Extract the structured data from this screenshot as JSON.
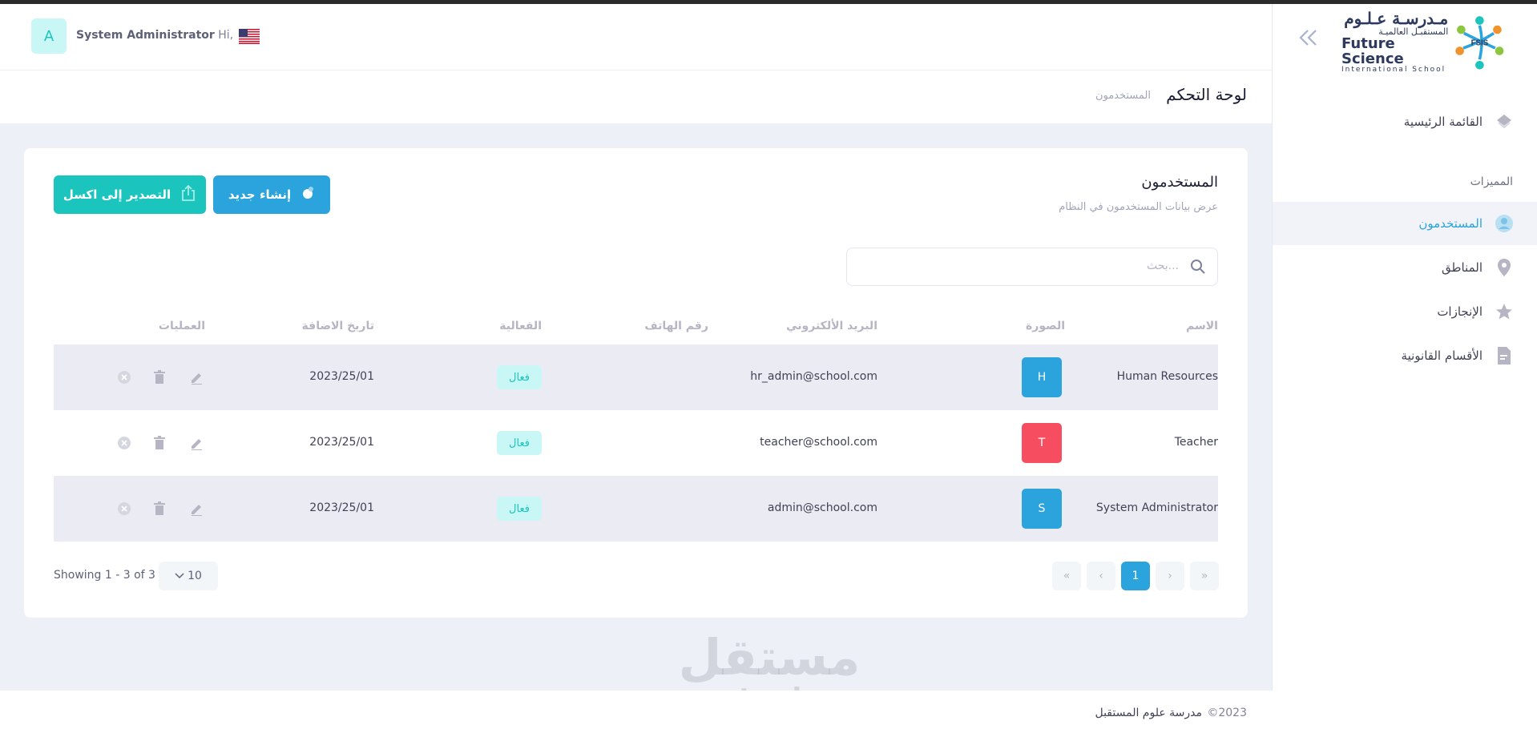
{
  "header": {
    "avatar_letter": "A",
    "greeting_prefix": "Hi,",
    "user_name": "System Administrator",
    "language_flag": "us-flag-icon"
  },
  "sidebar": {
    "logo": {
      "arabic_name": "مـدرسـة عـلـوم",
      "arabic_sub": "المستقبـل العالميـة",
      "english_name": "Future Science",
      "english_sub": "International School",
      "mark": "FSIS"
    },
    "main_menu": "القائمة الرئيسية",
    "section_title": "المميزات",
    "items": [
      {
        "label": "المستخدمون",
        "icon": "user-icon",
        "active": true
      },
      {
        "label": "المناطق",
        "icon": "map-pin-icon",
        "active": false
      },
      {
        "label": "الإنجازات",
        "icon": "star-icon",
        "active": false
      },
      {
        "label": "الأقسام القانونية",
        "icon": "document-icon",
        "active": false
      }
    ]
  },
  "subheader": {
    "title": "لوحة التحكم",
    "breadcrumb": "المستخدمون"
  },
  "card": {
    "title": "المستخدمون",
    "subtitle": "عرض بيانات المستخدمون في النظام",
    "new_button": "إنشاء جديد",
    "export_button": "التصدير إلى اكسل",
    "search_placeholder": "بحث..."
  },
  "table": {
    "columns": [
      "الاسم",
      "الصورة",
      "البريد الألكتروني",
      "رقم الهاتف",
      "الفعالية",
      "تاريخ الاضافة",
      "العمليات"
    ],
    "rows": [
      {
        "name": "Human Resources",
        "photo_letter": "H",
        "photo_color": "#2ba3dc",
        "email": "hr_admin@school.com",
        "phone": "",
        "status": "فعال",
        "date": "2023/25/01"
      },
      {
        "name": "Teacher",
        "photo_letter": "T",
        "photo_color": "#f64e60",
        "email": "teacher@school.com",
        "phone": "",
        "status": "فعال",
        "date": "2023/25/01"
      },
      {
        "name": "System Administrator",
        "photo_letter": "S",
        "photo_color": "#2ba3dc",
        "email": "admin@school.com",
        "phone": "",
        "status": "فعال",
        "date": "2023/25/01"
      }
    ]
  },
  "pagination": {
    "showing": "Showing 1 - 3 of 3",
    "per_page": "10",
    "current_page": "1"
  },
  "footer": {
    "copyright": "©2023",
    "school_name": "مدرسة علوم المستقبل"
  },
  "watermark": {
    "arabic": "مستقل",
    "english": "mostaql.com"
  },
  "colors": {
    "primary": "#2ba3dc",
    "success": "#1bc5bd",
    "danger": "#f64e60"
  }
}
